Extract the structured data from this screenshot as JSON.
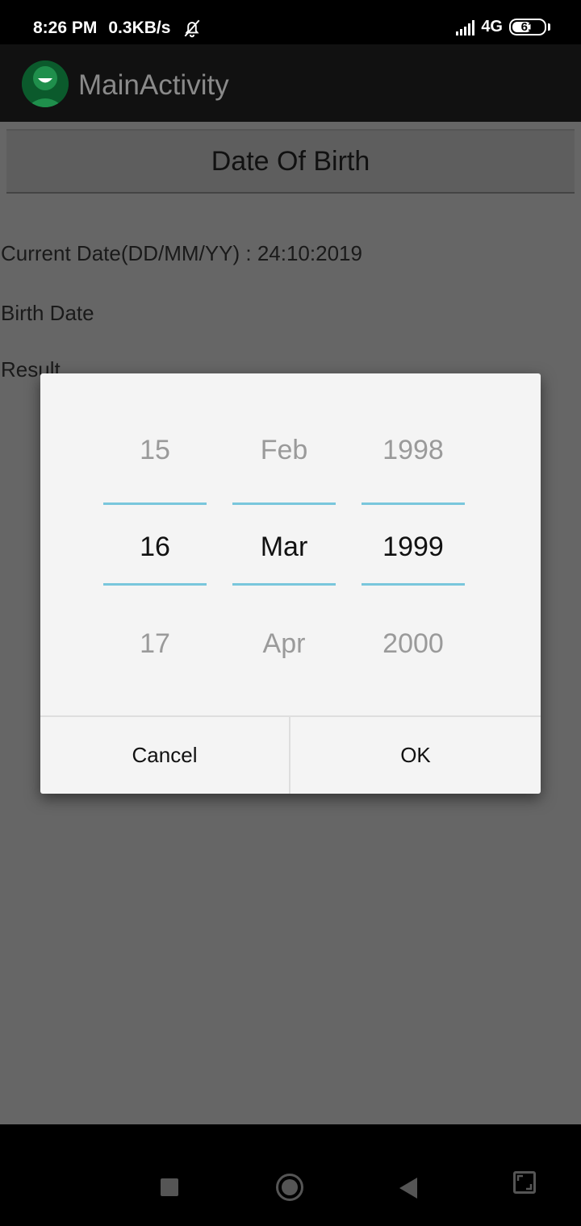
{
  "status_bar": {
    "time": "8:26 PM",
    "net_speed": "0.3KB/s",
    "network_type": "4G",
    "battery_level": "61",
    "battery_fraction": 0.61,
    "icons": [
      "bell-off-icon",
      "signal-icon",
      "battery-icon"
    ]
  },
  "app_bar": {
    "title": "MainActivity",
    "logo": "app-logo-icon"
  },
  "main": {
    "dob_button_label": "Date Of Birth",
    "current_date_text": "Current Date(DD/MM/YY) : 24:10:2019",
    "birth_date_label": "Birth Date",
    "result_label": "Result"
  },
  "dialog": {
    "day": {
      "prev": "15",
      "current": "16",
      "next": "17"
    },
    "month": {
      "prev": "Feb",
      "current": "Mar",
      "next": "Apr"
    },
    "year": {
      "prev": "1998",
      "current": "1999",
      "next": "2000"
    },
    "cancel_label": "Cancel",
    "ok_label": "OK"
  },
  "colors": {
    "picker_divider": "#79c6dc",
    "scrim": "#666666",
    "app_bar": "#111111"
  },
  "nav_bar": {
    "icons": [
      "recents-square-icon",
      "home-circle-icon",
      "back-triangle-icon",
      "rotate-icon"
    ]
  }
}
